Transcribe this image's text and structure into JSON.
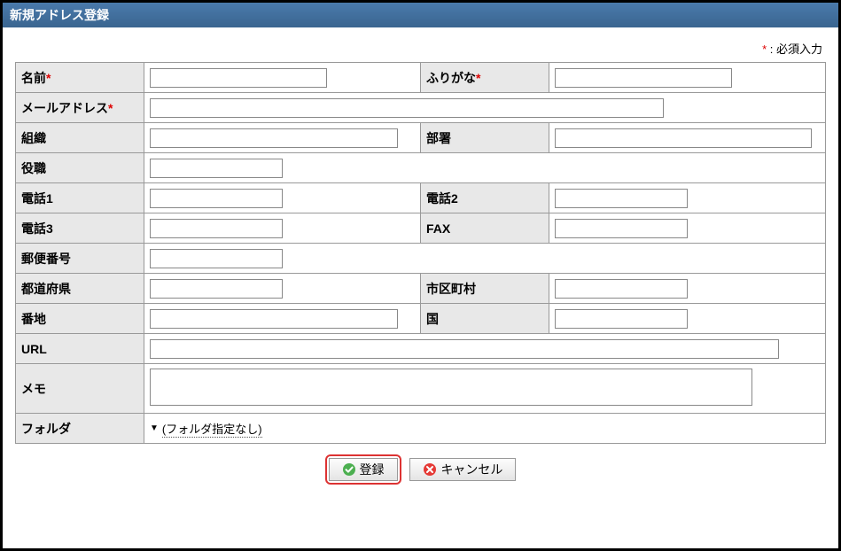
{
  "header": {
    "title": "新規アドレス登録"
  },
  "required_note": {
    "star": "*",
    "text": " : 必須入力"
  },
  "labels": {
    "name": "名前",
    "kana": "ふりがな",
    "email": "メールアドレス",
    "org": "組織",
    "dept": "部署",
    "title": "役職",
    "tel1": "電話1",
    "tel2": "電話2",
    "tel3": "電話3",
    "fax": "FAX",
    "zip": "郵便番号",
    "pref": "都道府県",
    "city": "市区町村",
    "street": "番地",
    "country": "国",
    "url": "URL",
    "memo": "メモ",
    "folder": "フォルダ"
  },
  "values": {
    "name": "",
    "kana": "",
    "email": "",
    "org": "",
    "dept": "",
    "title": "",
    "tel1": "",
    "tel2": "",
    "tel3": "",
    "fax": "",
    "zip": "",
    "pref": "",
    "city": "",
    "street": "",
    "country": "",
    "url": "",
    "memo": ""
  },
  "folder": {
    "selected": "(フォルダ指定なし)"
  },
  "buttons": {
    "submit": "登録",
    "cancel": "キャンセル"
  }
}
